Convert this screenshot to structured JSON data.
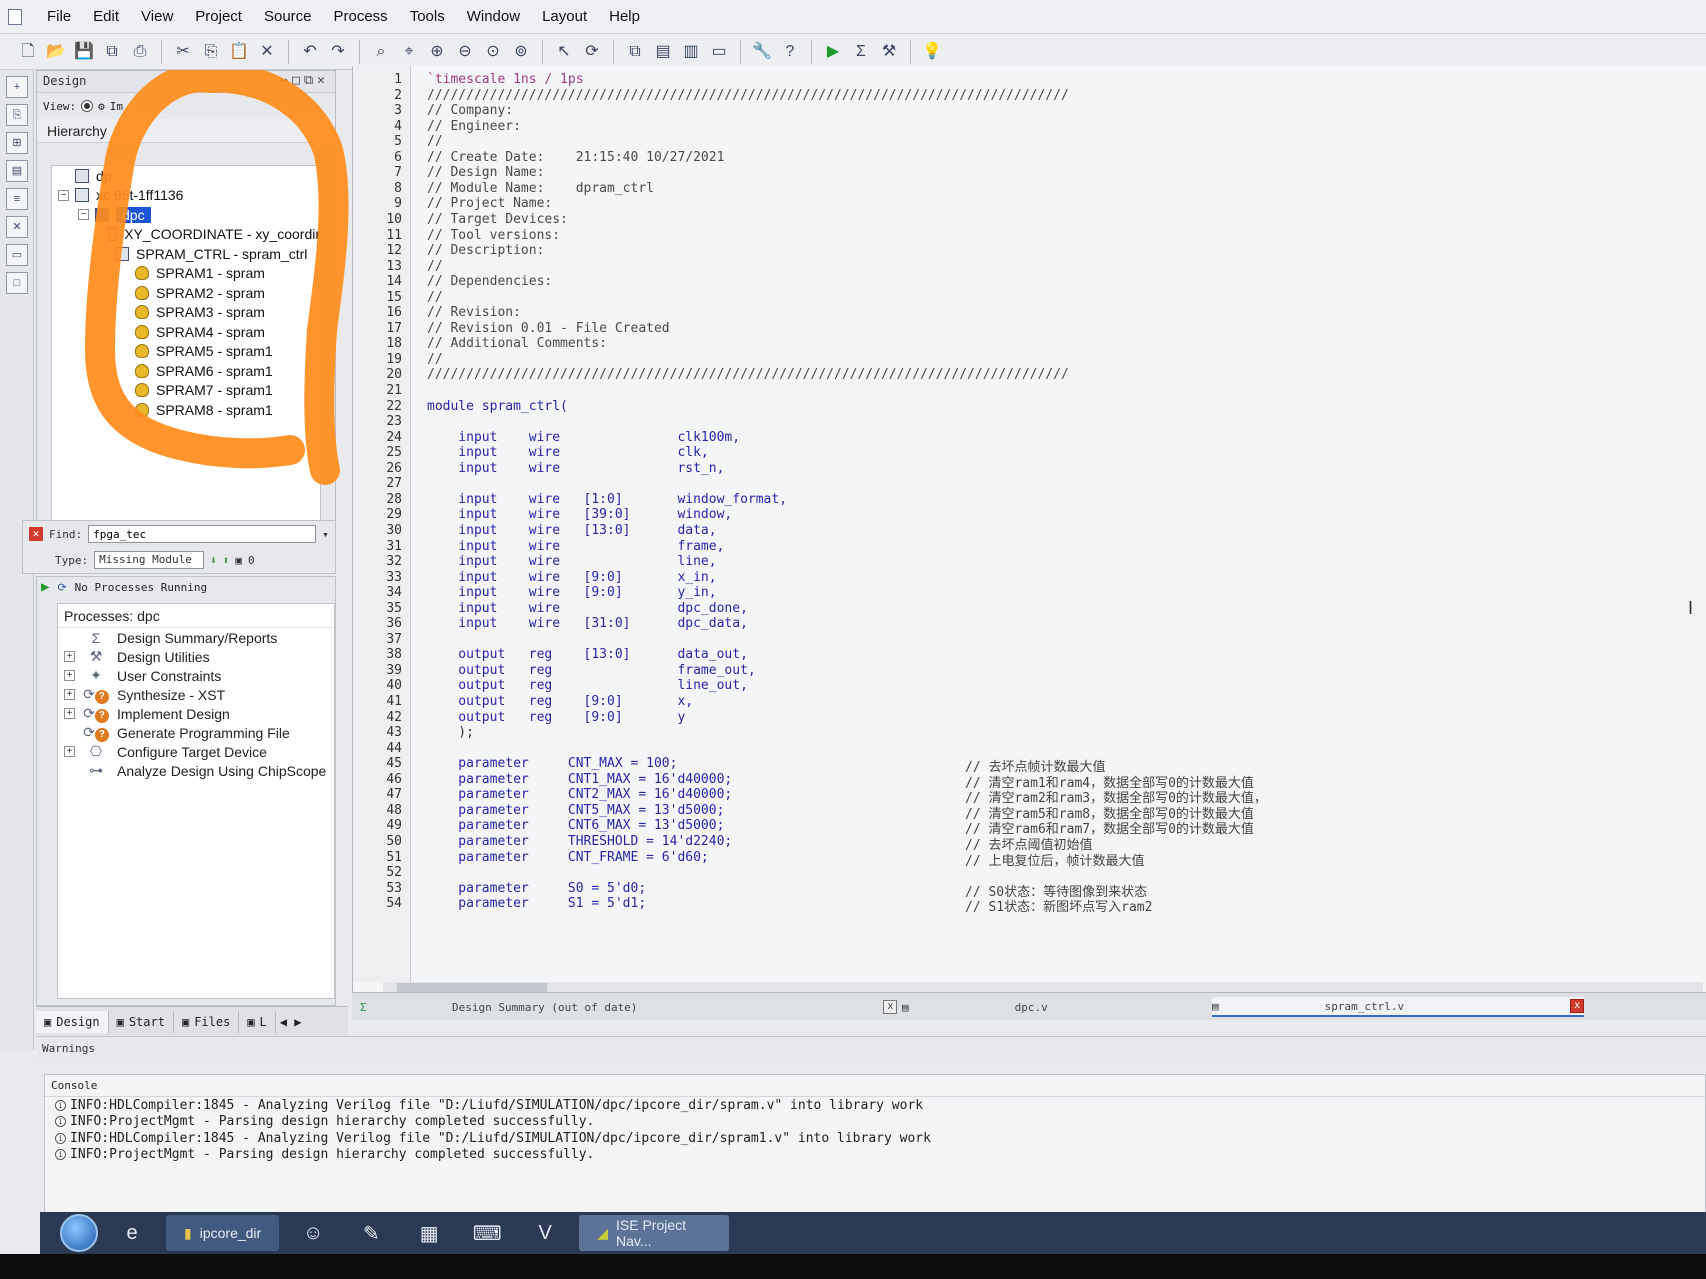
{
  "menu": [
    "File",
    "Edit",
    "View",
    "Project",
    "Source",
    "Process",
    "Tools",
    "Window",
    "Layout",
    "Help"
  ],
  "toolbar": {
    "icons": [
      "new-file-icon",
      "open-folder-icon",
      "save-icon",
      "save-all-icon",
      "print-icon",
      "cut-icon",
      "copy-icon",
      "paste-icon",
      "delete-icon",
      "undo-icon",
      "redo-icon",
      "find-icon",
      "find-in-files-icon",
      "zoom-in-icon",
      "zoom-out-icon",
      "zoom-fit-icon",
      "zoom-full-icon",
      "pointer-icon",
      "refresh-icon",
      "window-cascade-icon",
      "tile-horizontal-icon",
      "tile-vertical-icon",
      "float-icon",
      "properties-icon",
      "help-cursor-icon",
      "run-icon",
      "sigma-icon",
      "implement-icon",
      "lightbulb-icon"
    ]
  },
  "design_panel": {
    "title": "Design",
    "view_label": "View:",
    "view_option": "Im",
    "hierarchy_label": "Hierarchy",
    "tree": [
      {
        "label": "dp",
        "level": 0,
        "icon": "project-icon"
      },
      {
        "label": "xc     95t-1ff1136",
        "level": 0,
        "icon": "chip-icon",
        "expanded": true
      },
      {
        "label": "dpc",
        "level": 1,
        "icon": "verilog-module-icon",
        "selected": true,
        "expanded": true
      },
      {
        "label": "XY_COORDINATE - xy_coordir",
        "level": 2,
        "icon": "module-icon"
      },
      {
        "label": "SPRAM_CTRL - spram_ctrl",
        "level": 2,
        "icon": "module-icon"
      },
      {
        "label": "SPRAM1 - spram",
        "level": 3,
        "icon": "ip-core-icon"
      },
      {
        "label": "SPRAM2 - spram",
        "level": 3,
        "icon": "ip-core-icon"
      },
      {
        "label": "SPRAM3 - spram",
        "level": 3,
        "icon": "ip-core-icon"
      },
      {
        "label": "SPRAM4 - spram",
        "level": 3,
        "icon": "ip-core-icon"
      },
      {
        "label": "SPRAM5 - spram1",
        "level": 3,
        "icon": "ip-core-icon"
      },
      {
        "label": "SPRAM6 - spram1",
        "level": 3,
        "icon": "ip-core-icon"
      },
      {
        "label": "SPRAM7 - spram1",
        "level": 3,
        "icon": "ip-core-icon"
      },
      {
        "label": "SPRAM8 - spram1",
        "level": 3,
        "icon": "ip-core-icon"
      }
    ]
  },
  "annotation": {
    "color": "#ff8c1a"
  },
  "find": {
    "label": "Find:",
    "value": "fpga_tec",
    "type_label": "Type:",
    "type_value": "Missing Module",
    "count": "0"
  },
  "processes": {
    "status": "No Processes Running",
    "title": "Processes: dpc",
    "items": [
      {
        "label": "Design Summary/Reports",
        "icon": "sigma-icon",
        "expandable": false,
        "status": ""
      },
      {
        "label": "Design Utilities",
        "icon": "tools-icon",
        "expandable": true,
        "status": ""
      },
      {
        "label": "User Constraints",
        "icon": "constraints-icon",
        "expandable": true,
        "status": ""
      },
      {
        "label": "Synthesize - XST",
        "icon": "synthesize-icon",
        "expandable": true,
        "status": "?"
      },
      {
        "label": "Implement Design",
        "icon": "implement-icon",
        "expandable": true,
        "status": "?"
      },
      {
        "label": "Generate Programming File",
        "icon": "program-file-icon",
        "expandable": false,
        "status": "?"
      },
      {
        "label": "Configure Target Device",
        "icon": "device-icon",
        "expandable": true,
        "status": ""
      },
      {
        "label": "Analyze Design Using ChipScope",
        "icon": "chipscope-icon",
        "expandable": false,
        "status": ""
      }
    ]
  },
  "left_tabs": [
    {
      "label": "Design",
      "icon": "design-tab-icon",
      "active": true
    },
    {
      "label": "Start",
      "icon": "start-tab-icon",
      "active": false
    },
    {
      "label": "Files",
      "icon": "files-tab-icon",
      "active": false
    },
    {
      "label": "L",
      "icon": "libraries-tab-icon",
      "active": false
    }
  ],
  "editor": {
    "lines": [
      {
        "n": "1",
        "t": "`timescale 1ns / 1ps",
        "cls": "td"
      },
      {
        "n": "2",
        "t": "//////////////////////////////////////////////////////////////////////////////////",
        "cls": "cm"
      },
      {
        "n": "3",
        "t": "// Company:",
        "cls": "cm"
      },
      {
        "n": "4",
        "t": "// Engineer:",
        "cls": "cm"
      },
      {
        "n": "5",
        "t": "//",
        "cls": "cm"
      },
      {
        "n": "6",
        "t": "// Create Date:    21:15:40 10/27/2021",
        "cls": "cm"
      },
      {
        "n": "7",
        "t": "// Design Name:",
        "cls": "cm"
      },
      {
        "n": "8",
        "t": "// Module Name:    dpram_ctrl",
        "cls": "cm"
      },
      {
        "n": "9",
        "t": "// Project Name:",
        "cls": "cm"
      },
      {
        "n": "10",
        "t": "// Target Devices:",
        "cls": "cm"
      },
      {
        "n": "11",
        "t": "// Tool versions:",
        "cls": "cm"
      },
      {
        "n": "12",
        "t": "// Description:",
        "cls": "cm"
      },
      {
        "n": "13",
        "t": "//",
        "cls": "cm"
      },
      {
        "n": "14",
        "t": "// Dependencies:",
        "cls": "cm"
      },
      {
        "n": "15",
        "t": "//",
        "cls": "cm"
      },
      {
        "n": "16",
        "t": "// Revision:",
        "cls": "cm"
      },
      {
        "n": "17",
        "t": "// Revision 0.01 - File Created",
        "cls": "cm"
      },
      {
        "n": "18",
        "t": "// Additional Comments:",
        "cls": "cm"
      },
      {
        "n": "19",
        "t": "//",
        "cls": "cm"
      },
      {
        "n": "20",
        "t": "//////////////////////////////////////////////////////////////////////////////////",
        "cls": "cm"
      },
      {
        "n": "21",
        "t": "",
        "cls": ""
      },
      {
        "n": "22",
        "t": "module spram_ctrl(",
        "cls": "kw"
      },
      {
        "n": "23",
        "t": "",
        "cls": ""
      },
      {
        "n": "24",
        "t": "    input    wire               clk100m,",
        "cls": "kw"
      },
      {
        "n": "25",
        "t": "    input    wire               clk,",
        "cls": "kw"
      },
      {
        "n": "26",
        "t": "    input    wire               rst_n,",
        "cls": "kw"
      },
      {
        "n": "27",
        "t": "",
        "cls": ""
      },
      {
        "n": "28",
        "t": "    input    wire   [1:0]       window_format,",
        "cls": "kw"
      },
      {
        "n": "29",
        "t": "    input    wire   [39:0]      window,",
        "cls": "kw"
      },
      {
        "n": "30",
        "t": "    input    wire   [13:0]      data,",
        "cls": "kw"
      },
      {
        "n": "31",
        "t": "    input    wire               frame,",
        "cls": "kw"
      },
      {
        "n": "32",
        "t": "    input    wire               line,",
        "cls": "kw"
      },
      {
        "n": "33",
        "t": "    input    wire   [9:0]       x_in,",
        "cls": "kw"
      },
      {
        "n": "34",
        "t": "    input    wire   [9:0]       y_in,",
        "cls": "kw"
      },
      {
        "n": "35",
        "t": "    input    wire               dpc_done,",
        "cls": "kw"
      },
      {
        "n": "36",
        "t": "    input    wire   [31:0]      dpc_data,",
        "cls": "kw"
      },
      {
        "n": "37",
        "t": "",
        "cls": ""
      },
      {
        "n": "38",
        "t": "    output   reg    [13:0]      data_out,",
        "cls": "kw"
      },
      {
        "n": "39",
        "t": "    output   reg                frame_out,",
        "cls": "kw"
      },
      {
        "n": "40",
        "t": "    output   reg                line_out,",
        "cls": "kw"
      },
      {
        "n": "41",
        "t": "    output   reg    [9:0]       x,",
        "cls": "kw"
      },
      {
        "n": "42",
        "t": "    output   reg    [9:0]       y",
        "cls": "kw"
      },
      {
        "n": "43",
        "t": "    );",
        "cls": ""
      },
      {
        "n": "44",
        "t": "",
        "cls": ""
      },
      {
        "n": "45",
        "t": "    parameter     CNT_MAX = 100;",
        "cls": "kw"
      },
      {
        "n": "46",
        "t": "    parameter     CNT1_MAX = 16'd40000;",
        "cls": "kw"
      },
      {
        "n": "47",
        "t": "    parameter     CNT2_MAX = 16'd40000;",
        "cls": "kw"
      },
      {
        "n": "48",
        "t": "    parameter     CNT5_MAX = 13'd5000;",
        "cls": "kw"
      },
      {
        "n": "49",
        "t": "    parameter     CNT6_MAX = 13'd5000;",
        "cls": "kw"
      },
      {
        "n": "50",
        "t": "    parameter     THRESHOLD = 14'd2240;",
        "cls": "kw"
      },
      {
        "n": "51",
        "t": "    parameter     CNT_FRAME = 6'd60;",
        "cls": "kw"
      },
      {
        "n": "52",
        "t": "",
        "cls": ""
      },
      {
        "n": "53",
        "t": "    parameter     S0 = 5'd0;",
        "cls": "kw"
      },
      {
        "n": "54",
        "t": "    parameter     S1 = 5'd1;",
        "cls": "kw"
      }
    ],
    "comments": [
      {
        "n": "45",
        "t": "// 去坏点帧计数最大值"
      },
      {
        "n": "46",
        "t": "// 清空ram1和ram4，数据全部写0的计数最大值"
      },
      {
        "n": "47",
        "t": "// 清空ram2和ram3，数据全部写0的计数最大值，"
      },
      {
        "n": "48",
        "t": "// 清空ram5和ram8，数据全部写0的计数最大值"
      },
      {
        "n": "49",
        "t": "// 清空ram6和ram7，数据全部写0的计数最大值"
      },
      {
        "n": "50",
        "t": "// 去坏点阈值初始值"
      },
      {
        "n": "51",
        "t": "// 上电复位后，帧计数最大值"
      },
      {
        "n": "53",
        "t": "// S0状态：等待图像到来状态"
      },
      {
        "n": "54",
        "t": "// S1状态：新图坏点写入ram2"
      }
    ]
  },
  "editor_tabs": [
    {
      "label": "Design Summary (out of date)",
      "close": "x",
      "active": false
    },
    {
      "label": "dpc.v",
      "close": "x",
      "active": false
    },
    {
      "label": "spram_ctrl.v",
      "close": "x",
      "active": true
    }
  ],
  "warnings": {
    "title": "Warnings"
  },
  "console": {
    "title": "Console",
    "lines": [
      "INFO:HDLCompiler:1845 - Analyzing Verilog file \"D:/Liufd/SIMULATION/dpc/ipcore_dir/spram.v\" into library work",
      "INFO:ProjectMgmt - Parsing design hierarchy completed successfully.",
      "INFO:HDLCompiler:1845 - Analyzing Verilog file \"D:/Liufd/SIMULATION/dpc/ipcore_dir/spram1.v\" into library work",
      "INFO:ProjectMgmt - Parsing design hierarchy completed successfully."
    ]
  },
  "taskbar": {
    "items": [
      {
        "type": "icon",
        "name": "ie-icon",
        "glyph": "e"
      },
      {
        "type": "task",
        "name": "folder-icon",
        "label": "ipcore_dir"
      },
      {
        "type": "icon",
        "name": "user-icon",
        "glyph": "☺"
      },
      {
        "type": "icon",
        "name": "paint-icon",
        "glyph": "✎"
      },
      {
        "type": "icon",
        "name": "calculator-icon",
        "glyph": "▦"
      },
      {
        "type": "icon",
        "name": "keyboard-icon",
        "glyph": "⌨"
      },
      {
        "type": "icon",
        "name": "visio-icon",
        "glyph": "V"
      },
      {
        "type": "task",
        "name": "ise-icon",
        "label": "ISE Project Nav..."
      }
    ]
  }
}
